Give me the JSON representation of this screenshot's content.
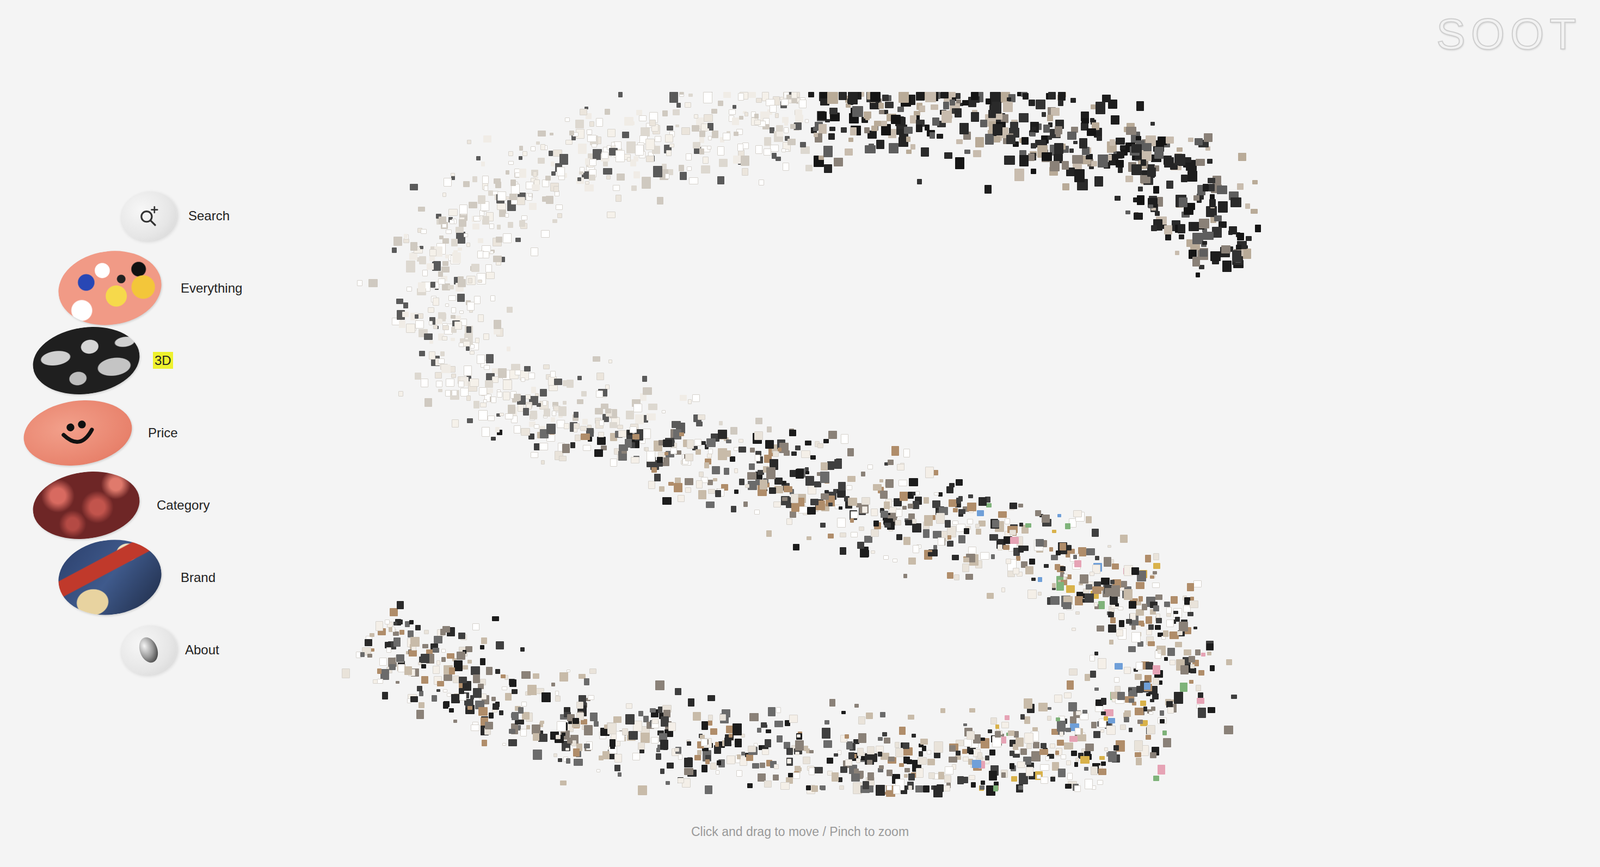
{
  "brand": {
    "logo": "SOOT"
  },
  "nav": [
    {
      "label": "Search",
      "kind": "icon",
      "selected": false
    },
    {
      "label": "Everything",
      "kind": "image",
      "selected": false
    },
    {
      "label": "3D",
      "kind": "image",
      "selected": true
    },
    {
      "label": "Price",
      "kind": "image",
      "selected": false
    },
    {
      "label": "Category",
      "kind": "image",
      "selected": false
    },
    {
      "label": "Brand",
      "kind": "image",
      "selected": false
    },
    {
      "label": "About",
      "kind": "icon",
      "selected": false
    }
  ],
  "hint": "Click and drag to move / Pinch to zoom"
}
